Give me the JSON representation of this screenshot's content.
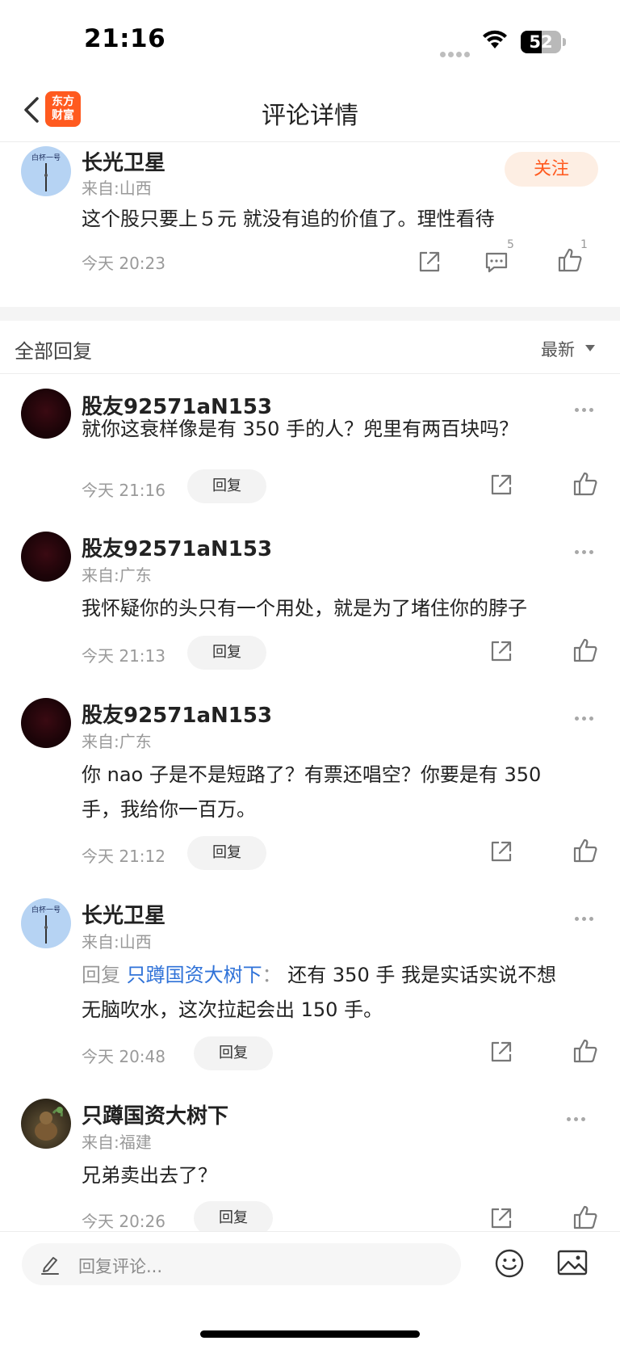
{
  "status_bar": {
    "time": "21:16",
    "battery": "52",
    "battery_level": 0.52
  },
  "nav": {
    "title": "评论详情",
    "logo_line1": "东方",
    "logo_line2": "财富"
  },
  "main_comment": {
    "username": "长光卫星",
    "location": "来自:山西",
    "follow_label": "关注",
    "content": "这个股只要上５元 就没有追的价值了。理性看待",
    "time": "今天 20:23",
    "comment_count": "5",
    "like_count": "1"
  },
  "replies_header": {
    "title": "全部回复",
    "sort": "最新"
  },
  "replies": [
    {
      "username": "股友92571aN153",
      "location": "",
      "content": "就你这衰样像是有 350 手的人？兜里有两百块吗？",
      "time": "今天 21:16",
      "reply_label": "回复"
    },
    {
      "username": "股友92571aN153",
      "location": "来自:广东",
      "content": "我怀疑你的头只有一个用处，就是为了堵住你的脖子",
      "time": "今天 21:13",
      "reply_label": "回复"
    },
    {
      "username": "股友92571aN153",
      "location": "来自:广东",
      "content_line1": "你 nao 子是不是短路了？有票还唱空？你要是有 350",
      "content_line2": "手，我给你一百万。",
      "time": "今天 21:12",
      "reply_label": "回复"
    },
    {
      "username": "长光卫星",
      "location": "来自:山西",
      "prefix": "回复",
      "mention": "只蹲国资大树下",
      "colon": "：",
      "content_line1": "还有 350 手 我是实话实说不想",
      "content_line2": "无脑吹水，这次拉起会出 150 手。",
      "time": "今天 20:48",
      "reply_label": "回复"
    },
    {
      "username": "只蹲国资大树下",
      "location": "来自:福建",
      "content": "兄弟卖出去了？",
      "time": "今天 20:26",
      "reply_label": "回复"
    }
  ],
  "bottom_bar": {
    "placeholder": "回复评论..."
  }
}
